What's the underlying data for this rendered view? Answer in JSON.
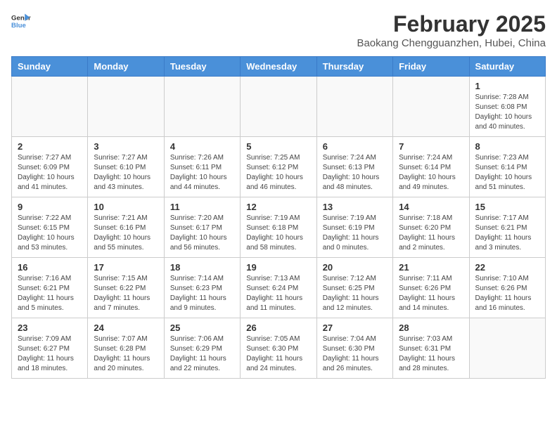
{
  "header": {
    "logo_general": "General",
    "logo_blue": "Blue",
    "title": "February 2025",
    "subtitle": "Baokang Chengguanzhen, Hubei, China"
  },
  "weekdays": [
    "Sunday",
    "Monday",
    "Tuesday",
    "Wednesday",
    "Thursday",
    "Friday",
    "Saturday"
  ],
  "weeks": [
    [
      {
        "day": "",
        "info": ""
      },
      {
        "day": "",
        "info": ""
      },
      {
        "day": "",
        "info": ""
      },
      {
        "day": "",
        "info": ""
      },
      {
        "day": "",
        "info": ""
      },
      {
        "day": "",
        "info": ""
      },
      {
        "day": "1",
        "info": "Sunrise: 7:28 AM\nSunset: 6:08 PM\nDaylight: 10 hours\nand 40 minutes."
      }
    ],
    [
      {
        "day": "2",
        "info": "Sunrise: 7:27 AM\nSunset: 6:09 PM\nDaylight: 10 hours\nand 41 minutes."
      },
      {
        "day": "3",
        "info": "Sunrise: 7:27 AM\nSunset: 6:10 PM\nDaylight: 10 hours\nand 43 minutes."
      },
      {
        "day": "4",
        "info": "Sunrise: 7:26 AM\nSunset: 6:11 PM\nDaylight: 10 hours\nand 44 minutes."
      },
      {
        "day": "5",
        "info": "Sunrise: 7:25 AM\nSunset: 6:12 PM\nDaylight: 10 hours\nand 46 minutes."
      },
      {
        "day": "6",
        "info": "Sunrise: 7:24 AM\nSunset: 6:13 PM\nDaylight: 10 hours\nand 48 minutes."
      },
      {
        "day": "7",
        "info": "Sunrise: 7:24 AM\nSunset: 6:14 PM\nDaylight: 10 hours\nand 49 minutes."
      },
      {
        "day": "8",
        "info": "Sunrise: 7:23 AM\nSunset: 6:14 PM\nDaylight: 10 hours\nand 51 minutes."
      }
    ],
    [
      {
        "day": "9",
        "info": "Sunrise: 7:22 AM\nSunset: 6:15 PM\nDaylight: 10 hours\nand 53 minutes."
      },
      {
        "day": "10",
        "info": "Sunrise: 7:21 AM\nSunset: 6:16 PM\nDaylight: 10 hours\nand 55 minutes."
      },
      {
        "day": "11",
        "info": "Sunrise: 7:20 AM\nSunset: 6:17 PM\nDaylight: 10 hours\nand 56 minutes."
      },
      {
        "day": "12",
        "info": "Sunrise: 7:19 AM\nSunset: 6:18 PM\nDaylight: 10 hours\nand 58 minutes."
      },
      {
        "day": "13",
        "info": "Sunrise: 7:19 AM\nSunset: 6:19 PM\nDaylight: 11 hours\nand 0 minutes."
      },
      {
        "day": "14",
        "info": "Sunrise: 7:18 AM\nSunset: 6:20 PM\nDaylight: 11 hours\nand 2 minutes."
      },
      {
        "day": "15",
        "info": "Sunrise: 7:17 AM\nSunset: 6:21 PM\nDaylight: 11 hours\nand 3 minutes."
      }
    ],
    [
      {
        "day": "16",
        "info": "Sunrise: 7:16 AM\nSunset: 6:21 PM\nDaylight: 11 hours\nand 5 minutes."
      },
      {
        "day": "17",
        "info": "Sunrise: 7:15 AM\nSunset: 6:22 PM\nDaylight: 11 hours\nand 7 minutes."
      },
      {
        "day": "18",
        "info": "Sunrise: 7:14 AM\nSunset: 6:23 PM\nDaylight: 11 hours\nand 9 minutes."
      },
      {
        "day": "19",
        "info": "Sunrise: 7:13 AM\nSunset: 6:24 PM\nDaylight: 11 hours\nand 11 minutes."
      },
      {
        "day": "20",
        "info": "Sunrise: 7:12 AM\nSunset: 6:25 PM\nDaylight: 11 hours\nand 12 minutes."
      },
      {
        "day": "21",
        "info": "Sunrise: 7:11 AM\nSunset: 6:26 PM\nDaylight: 11 hours\nand 14 minutes."
      },
      {
        "day": "22",
        "info": "Sunrise: 7:10 AM\nSunset: 6:26 PM\nDaylight: 11 hours\nand 16 minutes."
      }
    ],
    [
      {
        "day": "23",
        "info": "Sunrise: 7:09 AM\nSunset: 6:27 PM\nDaylight: 11 hours\nand 18 minutes."
      },
      {
        "day": "24",
        "info": "Sunrise: 7:07 AM\nSunset: 6:28 PM\nDaylight: 11 hours\nand 20 minutes."
      },
      {
        "day": "25",
        "info": "Sunrise: 7:06 AM\nSunset: 6:29 PM\nDaylight: 11 hours\nand 22 minutes."
      },
      {
        "day": "26",
        "info": "Sunrise: 7:05 AM\nSunset: 6:30 PM\nDaylight: 11 hours\nand 24 minutes."
      },
      {
        "day": "27",
        "info": "Sunrise: 7:04 AM\nSunset: 6:30 PM\nDaylight: 11 hours\nand 26 minutes."
      },
      {
        "day": "28",
        "info": "Sunrise: 7:03 AM\nSunset: 6:31 PM\nDaylight: 11 hours\nand 28 minutes."
      },
      {
        "day": "",
        "info": ""
      }
    ]
  ]
}
